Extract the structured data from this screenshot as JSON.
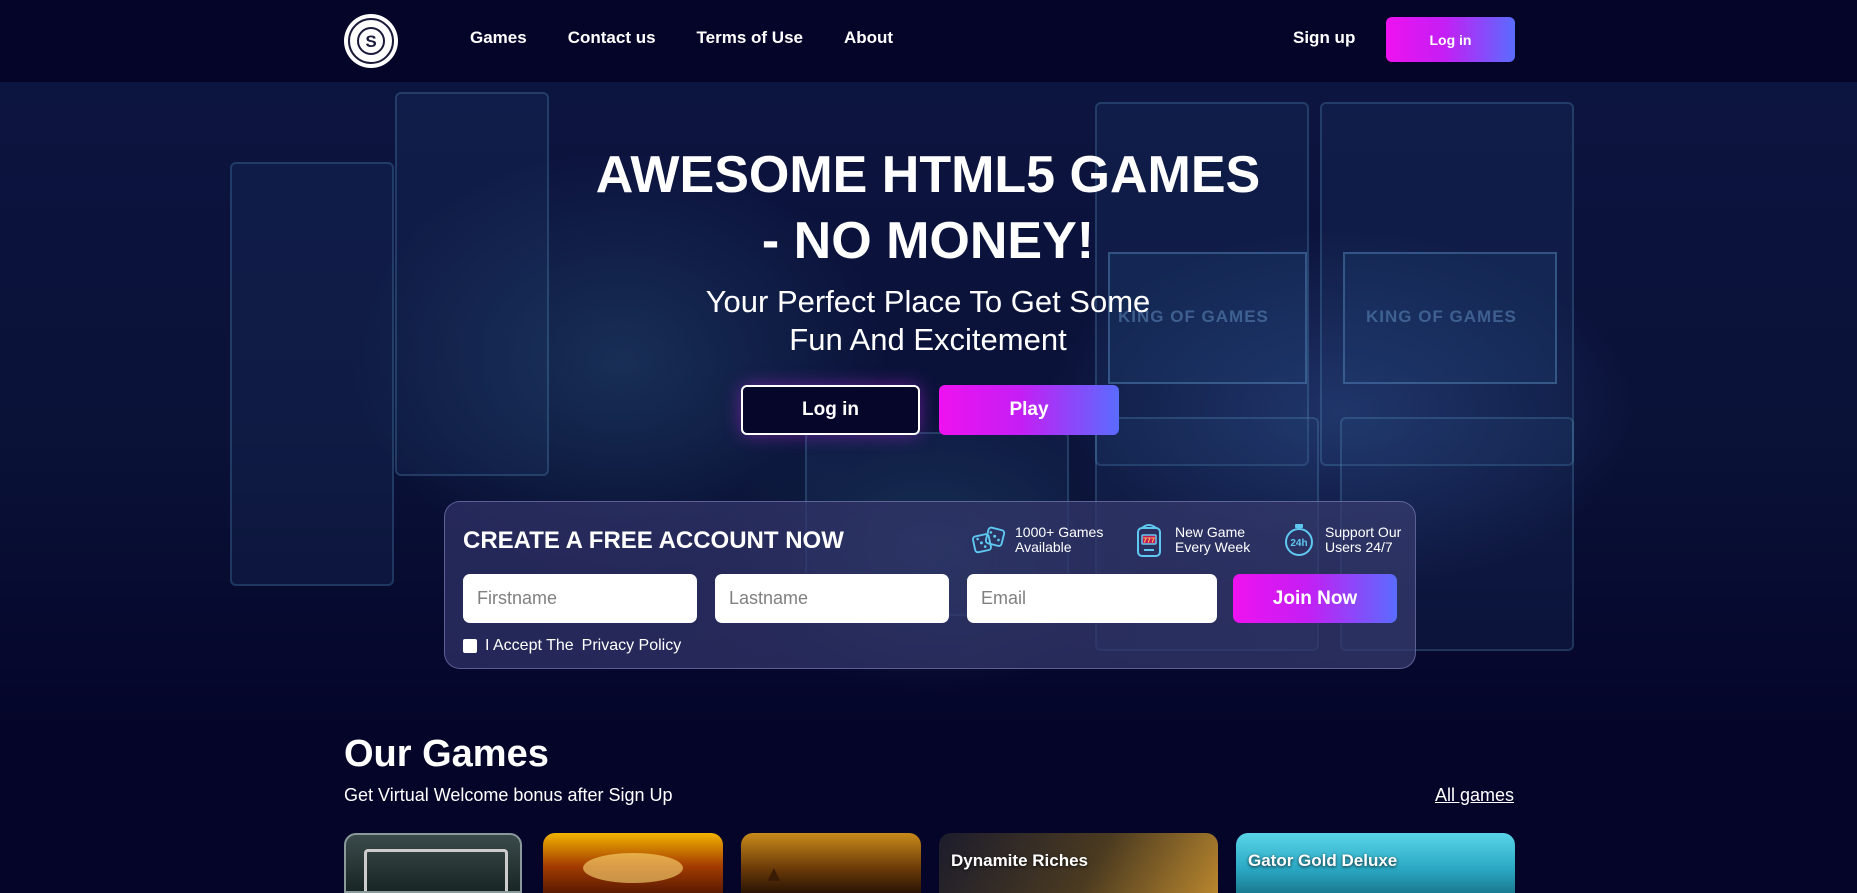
{
  "header": {
    "logo_alt": "SOCIAL WNS NEW",
    "nav": [
      "Games",
      "Contact us",
      "Terms of Use",
      "About"
    ],
    "signup_label": "Sign up",
    "login_label": "Log in"
  },
  "hero": {
    "title_line1": "AWESOME HTML5 GAMES",
    "title_line2": "- NO MONEY!",
    "subtitle_line1": "Your Perfect Place To Get Some",
    "subtitle_line2": "Fun And Excitement",
    "login_label": "Log in",
    "play_label": "Play",
    "bg_signs": [
      "KING OF GAMES",
      "KING OF GAMES"
    ]
  },
  "signup_form": {
    "title": "CREATE A FREE ACCOUNT NOW",
    "features": [
      {
        "icon": "dice-icon",
        "line1": "1000+ Games",
        "line2": "Available"
      },
      {
        "icon": "slot-machine-icon",
        "line1": "New Game",
        "line2": "Every Week"
      },
      {
        "icon": "support-24h-icon",
        "line1": "Support Our",
        "line2": "Users 24/7"
      }
    ],
    "firstname_placeholder": "Firstname",
    "lastname_placeholder": "Lastname",
    "email_placeholder": "Email",
    "join_label": "Join Now",
    "privacy_prefix": "I Accept The",
    "privacy_link": "Privacy Policy"
  },
  "games": {
    "title": "Our Games",
    "subtitle": "Get Virtual Welcome bonus after Sign Up",
    "all_games_label": "All games",
    "cards": [
      {
        "name": ""
      },
      {
        "name": ""
      },
      {
        "name": ""
      },
      {
        "name": "Dynamite Riches"
      },
      {
        "name": "Gator Gold Deluxe"
      }
    ]
  },
  "colors": {
    "background": "#05052a",
    "accent_start": "#ee12f0",
    "accent_end": "#5a6cff"
  }
}
